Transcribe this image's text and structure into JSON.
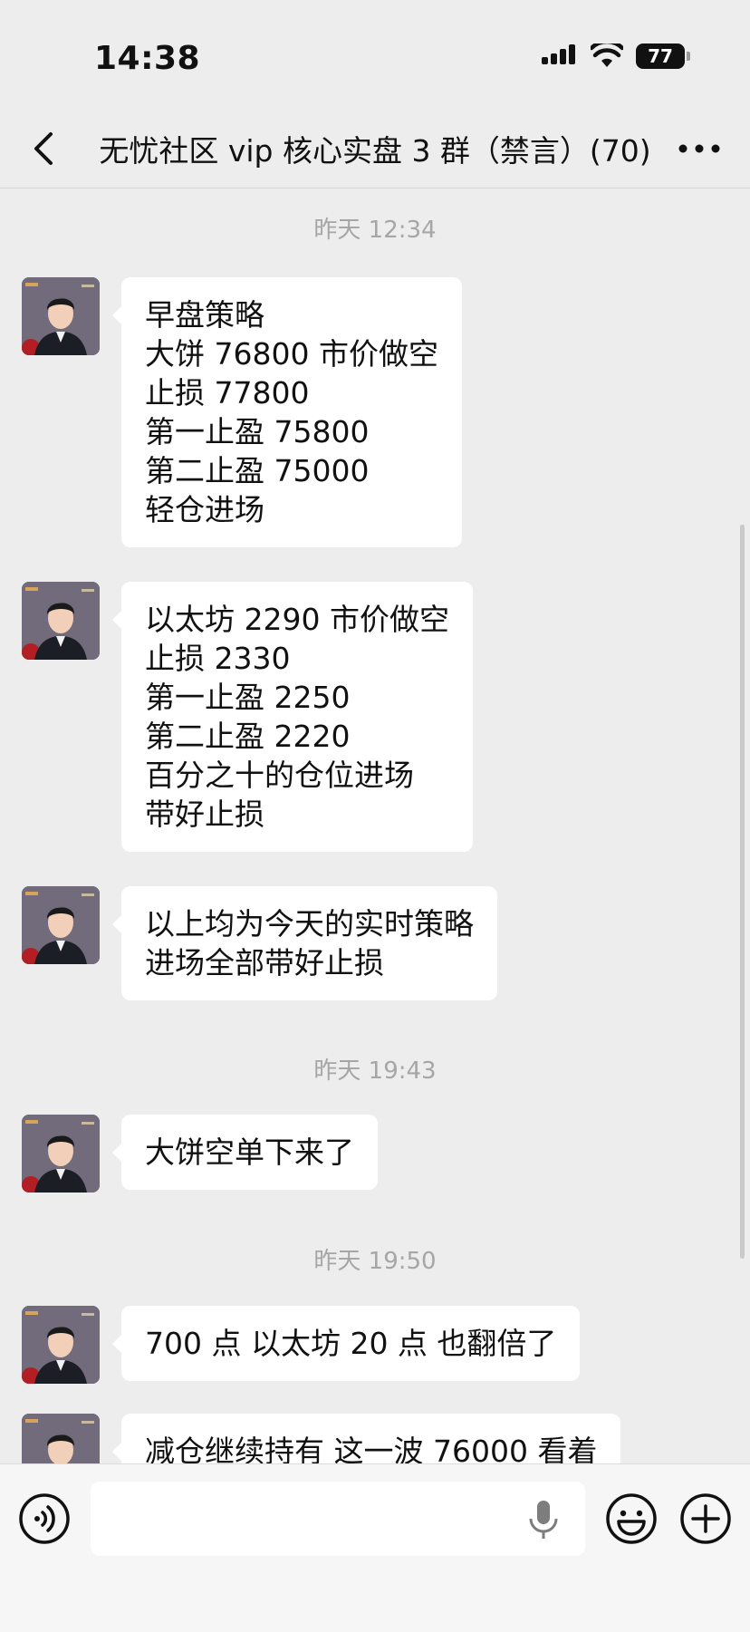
{
  "status_bar": {
    "time": "14:38",
    "battery": "77"
  },
  "nav": {
    "title": "无忧社区 vip 核心实盘 3 群（禁言）(70)"
  },
  "messages": [
    {
      "type": "time",
      "text": "昨天 12:34"
    },
    {
      "type": "text",
      "text": "早盘策略\n大饼 76800 市价做空\n止损 77800\n第一止盈 75800\n第二止盈 75000\n轻仓进场"
    },
    {
      "type": "text",
      "text": "以太坊 2290 市价做空\n止损 2330\n第一止盈 2250\n第二止盈 2220\n百分之十的仓位进场\n带好止损"
    },
    {
      "type": "text",
      "text": "以上均为今天的实时策略\n进场全部带好止损"
    },
    {
      "type": "time",
      "text": "昨天 19:43"
    },
    {
      "type": "text",
      "text": "大饼空单下来了"
    },
    {
      "type": "time",
      "text": "昨天 19:50"
    },
    {
      "type": "text",
      "text": "700 点 以太坊 20 点 也翻倍了"
    },
    {
      "type": "text",
      "text": "减仓继续持有 这一波 76000 看着"
    }
  ],
  "input_bar": {
    "value": ""
  },
  "icons": {
    "back": "chevron-left-icon",
    "more": "more-horizontal-icon",
    "voice": "voice-icon",
    "mic": "microphone-icon",
    "emoji": "emoji-icon",
    "plus": "plus-icon"
  }
}
